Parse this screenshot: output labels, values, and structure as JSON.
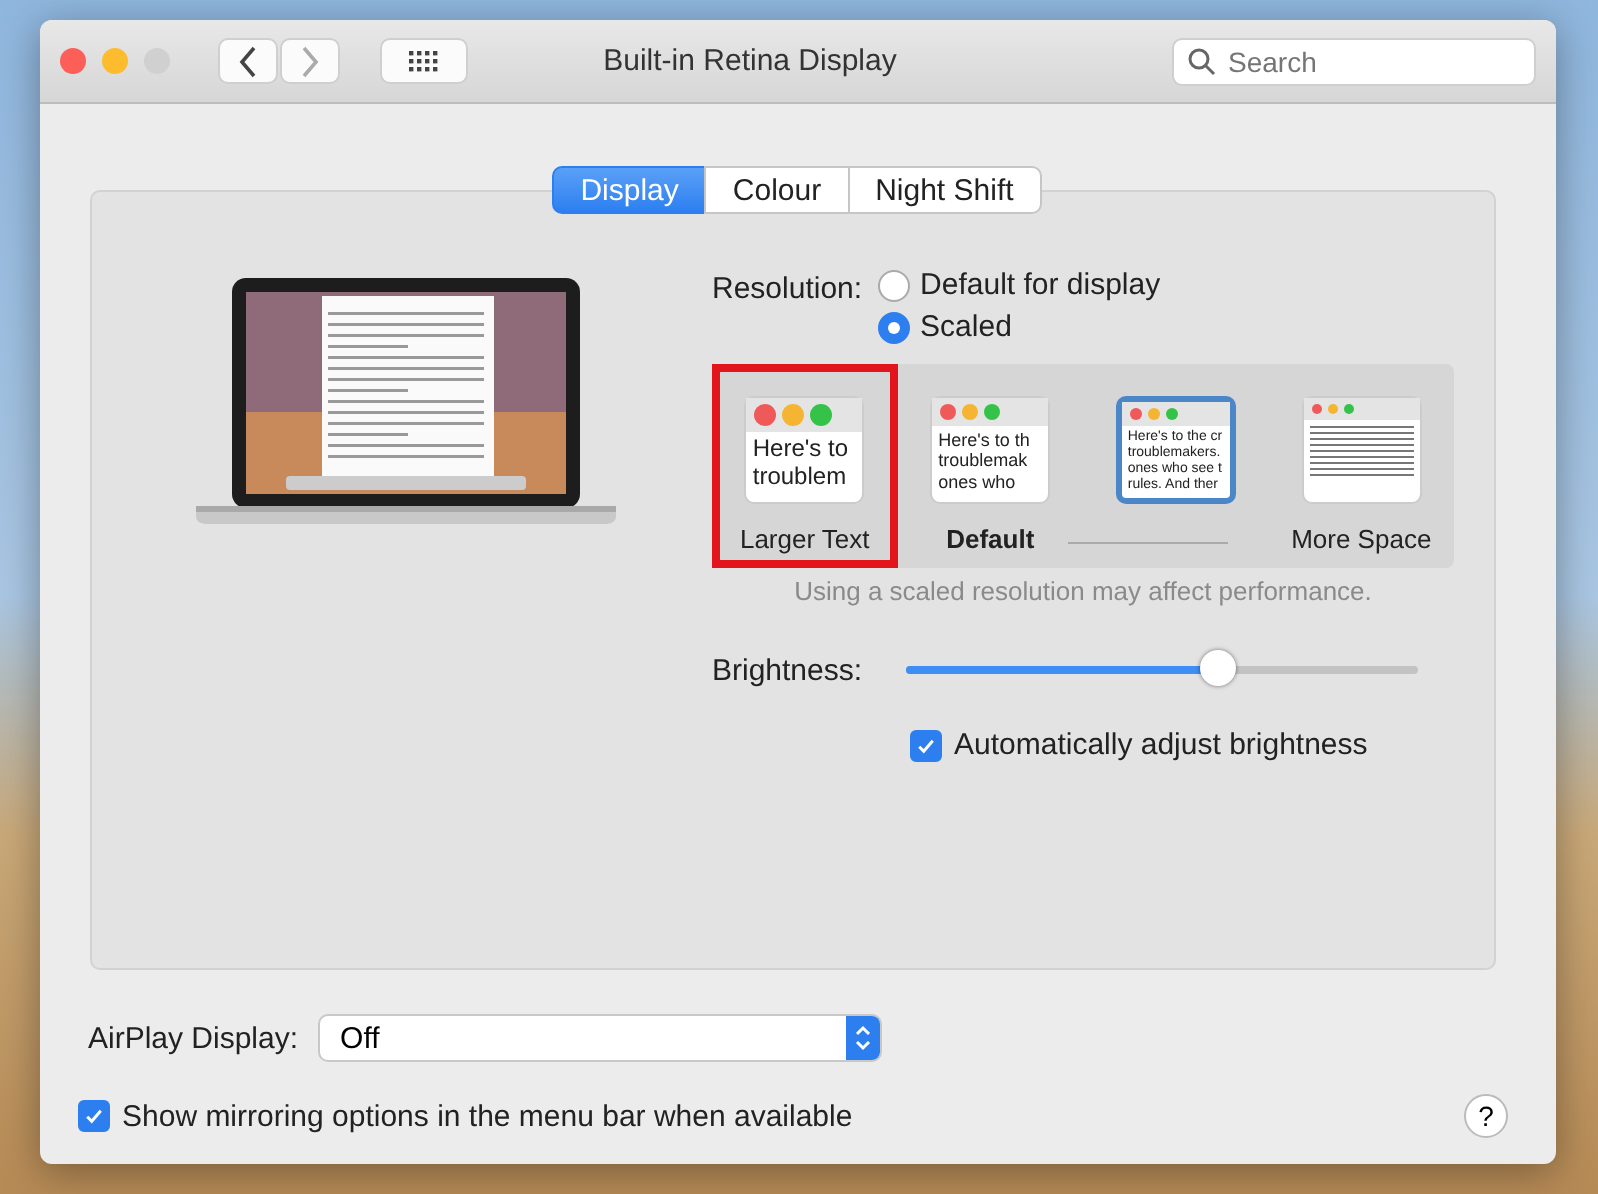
{
  "window": {
    "title": "Built-in Retina Display"
  },
  "search": {
    "placeholder": "Search"
  },
  "tabs": [
    {
      "label": "Display",
      "selected": true
    },
    {
      "label": "Colour",
      "selected": false
    },
    {
      "label": "Night Shift",
      "selected": false
    }
  ],
  "resolution": {
    "label": "Resolution:",
    "options": [
      {
        "label": "Default for display",
        "selected": false
      },
      {
        "label": "Scaled",
        "selected": true
      }
    ]
  },
  "scale_options": [
    {
      "label": "Larger Text",
      "is_default": false,
      "selected": false,
      "highlighted": true,
      "preview": [
        "Here's to",
        "troublem"
      ]
    },
    {
      "label": "Default",
      "is_default": true,
      "selected": false,
      "highlighted": false,
      "preview": [
        "Here's to th",
        "troublemak",
        "ones who"
      ]
    },
    {
      "selected": true,
      "highlighted": false,
      "preview": [
        "Here's to the cr",
        "troublemakers.",
        "ones who see t",
        "rules. And ther"
      ]
    },
    {
      "label": "More Space",
      "is_default": false,
      "selected": false,
      "highlighted": false
    }
  ],
  "note": "Using a scaled resolution may affect performance.",
  "brightness": {
    "label": "Brightness:",
    "level": 0.61
  },
  "auto_brightness": {
    "label": "Automatically adjust brightness",
    "checked": true
  },
  "airplay": {
    "label": "AirPlay Display:",
    "value": "Off"
  },
  "mirroring": {
    "label": "Show mirroring options in the menu bar when available",
    "checked": true
  },
  "help": "?"
}
